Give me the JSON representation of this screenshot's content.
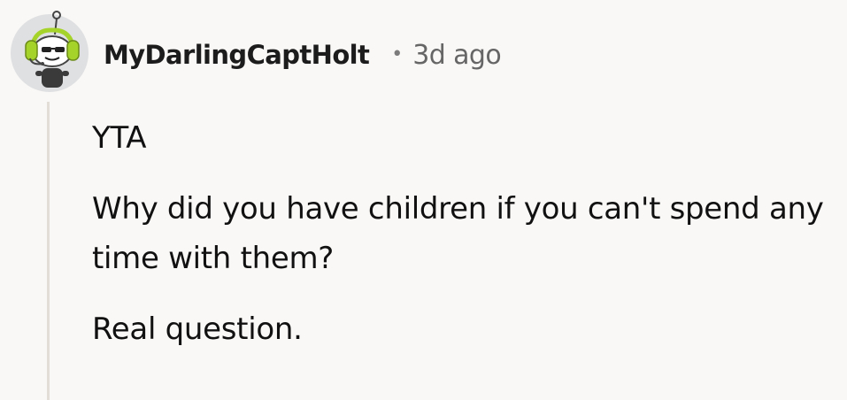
{
  "comment": {
    "author": "MyDarlingCaptHolt",
    "separator": "•",
    "timestamp": "3d ago",
    "avatar_icon": "snoo-headphones-avatar-icon",
    "paragraphs": [
      "YTA",
      "Why did you have children if you can't spend any time with them?",
      "Real question."
    ]
  },
  "colors": {
    "background": "#faf8f6",
    "text": "#111111",
    "meta": "#666666",
    "thread_line": "#e3ddd7",
    "headphones": "#a6d32a"
  }
}
